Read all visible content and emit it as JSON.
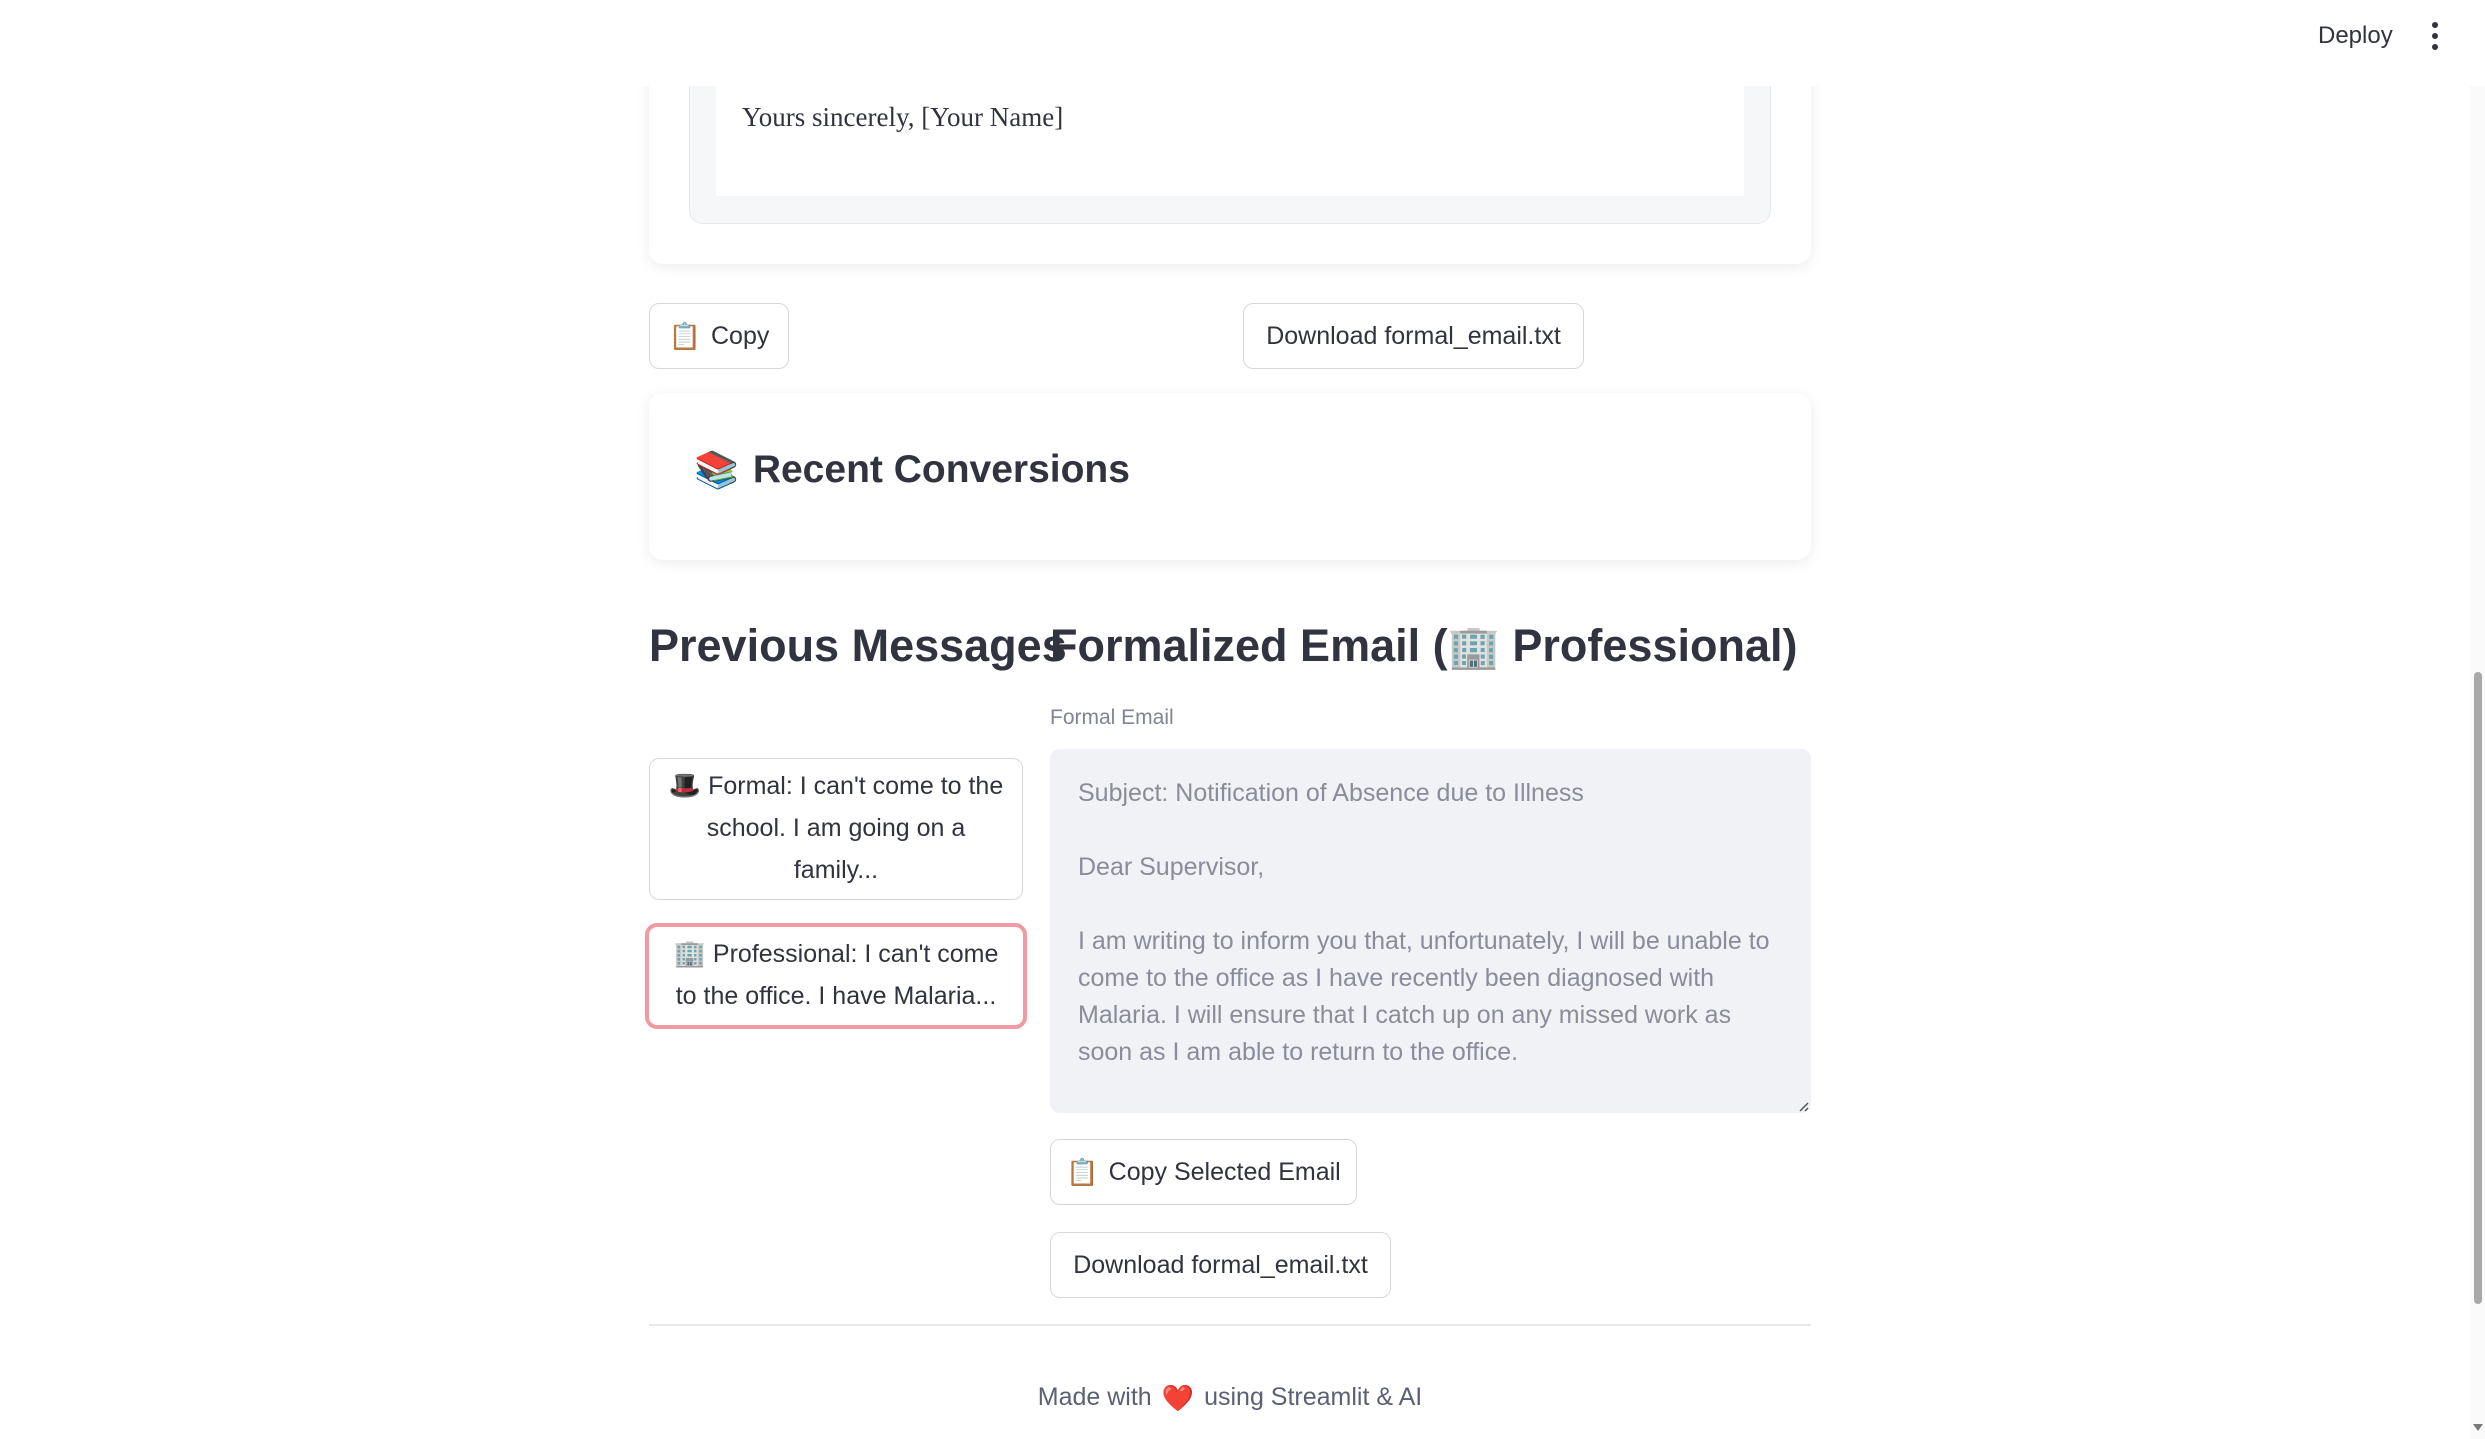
{
  "header": {
    "deploy_label": "Deploy",
    "menu_icon": "vertical-ellipsis-icon"
  },
  "top_card": {
    "closing_text": "Yours sincerely, [Your Name]"
  },
  "actions": {
    "copy_icon": "📋",
    "copy_label": "Copy",
    "download_label": "Download formal_email.txt"
  },
  "recent": {
    "icon": "📚",
    "title": "Recent Conversions"
  },
  "previous": {
    "heading": "Previous Messages",
    "items": [
      {
        "icon": "🎩",
        "label": "Formal: I can't come to the school. I am going on a family..."
      },
      {
        "icon": "🏢",
        "label": "Professional: I can't come to the office. I have Malaria...",
        "selected": true
      }
    ]
  },
  "formalized": {
    "heading_prefix": "Formalized Email (",
    "heading_icon": "🏢",
    "heading_suffix": " Professional)",
    "field_label": "Formal Email",
    "email_text": "Subject: Notification of Absence due to Illness\n\nDear Supervisor,\n\nI am writing to inform you that, unfortunately, I will be unable to come to the office as I have recently been diagnosed with Malaria. I will ensure that I catch up on any missed work as soon as I am able to return to the office.",
    "copy_icon": "📋",
    "copy_selected_label": "Copy Selected Email",
    "download_label": "Download formal_email.txt"
  },
  "footer": {
    "prefix": "Made with",
    "heart": "❤️",
    "suffix": "using Streamlit & AI"
  },
  "colors": {
    "selected_border": "#f19aa1",
    "textarea_bg": "#f0f2f6",
    "text": "#31333f"
  }
}
